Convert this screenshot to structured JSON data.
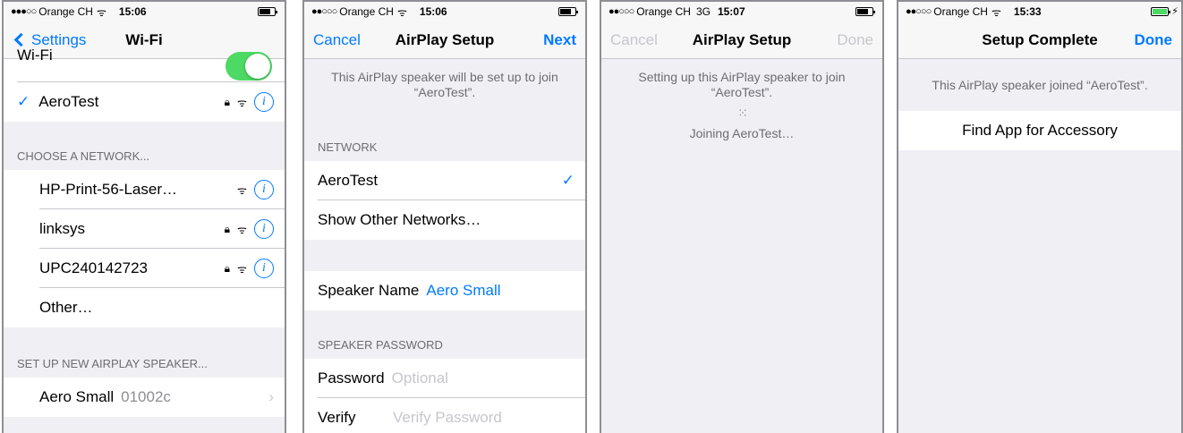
{
  "panel1": {
    "status": {
      "signal": "●●●○○",
      "carrier": "Orange CH",
      "time": "15:06"
    },
    "nav": {
      "back": "Settings",
      "title": "Wi-Fi"
    },
    "wifi_toggle_label": "Wi-Fi",
    "connected": {
      "name": "AeroTest"
    },
    "choose_header": "CHOOSE A NETWORK...",
    "networks": [
      {
        "name": "HP-Print-56-Laser…",
        "locked": false
      },
      {
        "name": "linksys",
        "locked": true
      },
      {
        "name": "UPC240142723",
        "locked": true
      }
    ],
    "other": "Other…",
    "airplay_header": "SET UP NEW AIRPLAY SPEAKER...",
    "speaker": {
      "name": "Aero Small",
      "id": "01002c"
    }
  },
  "panel2": {
    "status": {
      "signal": "●●○○○",
      "carrier": "Orange CH",
      "time": "15:06"
    },
    "nav": {
      "cancel": "Cancel",
      "title": "AirPlay Setup",
      "next": "Next"
    },
    "message": "This AirPlay speaker will be set up to join “AeroTest”.",
    "network_header": "NETWORK",
    "network_selected": "AeroTest",
    "show_other": "Show Other Networks…",
    "speaker_name_label": "Speaker Name",
    "speaker_name_value": "Aero Small",
    "password_header": "SPEAKER PASSWORD",
    "password_label": "Password",
    "password_placeholder": "Optional",
    "verify_label": "Verify",
    "verify_placeholder": "Verify Password"
  },
  "panel3": {
    "status": {
      "signal": "●●○○○",
      "carrier": "Orange CH",
      "network": "3G",
      "time": "15:07"
    },
    "nav": {
      "cancel": "Cancel",
      "title": "AirPlay Setup",
      "done": "Done"
    },
    "message": "Setting up this AirPlay speaker to join “AeroTest”.",
    "joining": "Joining AeroTest…"
  },
  "panel4": {
    "status": {
      "signal": "●●○○○",
      "carrier": "Orange CH",
      "time": "15:33"
    },
    "nav": {
      "title": "Setup Complete",
      "done": "Done"
    },
    "message": "This AirPlay speaker joined “AeroTest”.",
    "find_app": "Find App for Accessory"
  },
  "icons": {
    "wifi": "wifi-icon",
    "lock": "lock-icon",
    "info": "info-icon",
    "checkmark": "checkmark-icon",
    "chevron": "chevron-right-icon",
    "spinner": "spinner-icon"
  },
  "colors": {
    "accent": "#007aff",
    "toggle_on": "#4cd964",
    "group_bg": "#efeff4"
  }
}
